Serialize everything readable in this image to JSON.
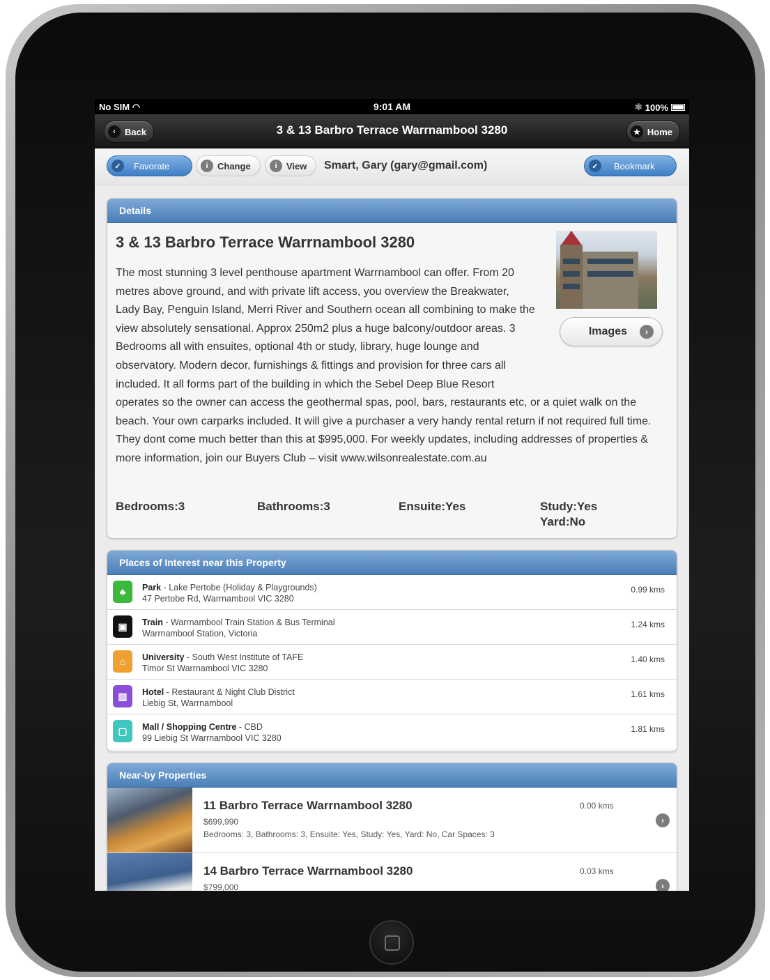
{
  "status_bar": {
    "carrier": "No SIM",
    "time": "9:01 AM",
    "battery": "100%"
  },
  "nav": {
    "back_label": "Back",
    "title": "3 & 13 Barbro Terrace Warrnambool 3280",
    "home_label": "Home"
  },
  "toolbar": {
    "favorite_label": "Favorate",
    "change_label": "Change",
    "view_label": "View",
    "user": "Smart, Gary (gary@gmail.com)",
    "bookmark_label": "Bookmark"
  },
  "details": {
    "header": "Details",
    "title": "3 & 13 Barbro Terrace Warrnambool 3280",
    "description": "The most stunning 3 level penthouse apartment Warrnambool can offer. From 20 metres above ground, and with private lift access, you overview the Breakwater, Lady Bay, Penguin Island, Merri River and Southern ocean all combining to make the view absolutely sensational. Approx 250m2 plus a huge balcony/outdoor areas. 3 Bedrooms all with ensuites, optional 4th or study, library, huge lounge and observatory. Modern decor, furnishings & fittings and provision for three cars all included. It all forms part of the building in which the Sebel Deep Blue Resort operates so the owner can access the geothermal spas, pool, bars, restaurants etc, or a quiet walk on the beach. Your own carparks included. It will give a purchaser a very handy rental return if not required full time. They dont come much better than this at $995,000. For weekly updates, including addresses of properties & more information, join our Buyers Club – visit www.wilsonrealestate.com.au",
    "images_label": "Images",
    "bedrooms": "Bedrooms:3",
    "bathrooms": "Bathrooms:3",
    "ensuite": "Ensuite:Yes",
    "study": "Study:Yes",
    "yard": "Yard:No"
  },
  "places": {
    "header": "Places of Interest near this Property",
    "items": [
      {
        "category": "Park",
        "name": " - Lake Pertobe (Holiday & Playgrounds)",
        "address": "47 Pertobe Rd, Warrnambool VIC 3280",
        "distance": "0.99 kms",
        "color": "#3cb83a",
        "icon": "tree-icon",
        "glyph": "♣"
      },
      {
        "category": "Train",
        "name": " - Warrnambool Train Station & Bus Terminal",
        "address": "Warrnambool Station, Victoria",
        "distance": "1.24 kms",
        "color": "#111111",
        "icon": "train-icon",
        "glyph": "▣"
      },
      {
        "category": "University",
        "name": " - South West Institute of TAFE",
        "address": "Timor St Warrnambool VIC 3280",
        "distance": "1.40 kms",
        "color": "#f0a030",
        "icon": "graduation-cap-icon",
        "glyph": "⌂"
      },
      {
        "category": "Hotel",
        "name": " - Restaurant & Night Club District",
        "address": "Liebig St, Warrnambool",
        "distance": "1.61 kms",
        "color": "#8a4fd6",
        "icon": "hotel-icon",
        "glyph": "▥"
      },
      {
        "category": "Mall / Shopping Centre",
        "name": " - CBD",
        "address": "99 Liebig St Warrnambool VIC 3280",
        "distance": "1.81 kms",
        "color": "#3fc6bf",
        "icon": "shopping-bag-icon",
        "glyph": "▢"
      }
    ]
  },
  "nearby": {
    "header": "Near-by Properties",
    "items": [
      {
        "title": "11 Barbro Terrace Warrnambool 3280",
        "price": "$699,990",
        "desc": "Bedrooms: 3, Bathrooms: 3, Ensuite: Yes, Study: Yes, Yard: No, Car Spaces: 3",
        "distance": "0.00 kms"
      },
      {
        "title": "14 Barbro Terrace Warrnambool 3280",
        "price": "$799,000",
        "desc": "",
        "distance": "0.03 kms"
      }
    ]
  }
}
